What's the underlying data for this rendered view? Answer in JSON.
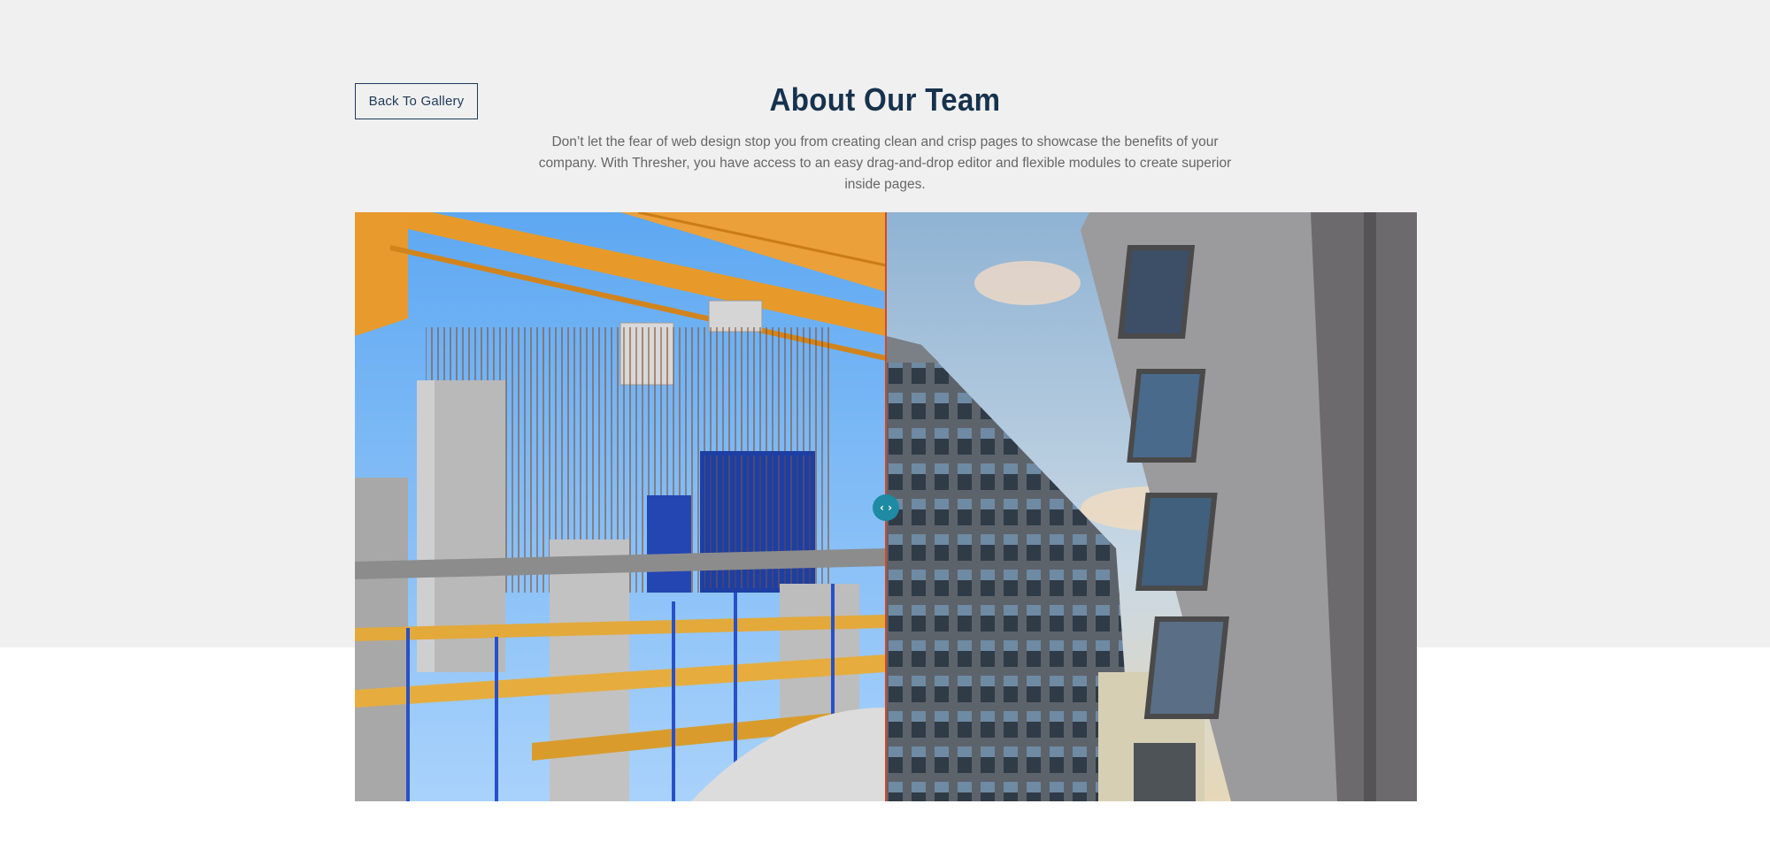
{
  "header": {
    "back_label": "Back To Gallery",
    "title": "About Our Team",
    "description": "Don’t let the fear of web design stop you from creating clean and crisp pages to showcase the benefits of your company. With Thresher, you have access to an easy drag-and-drop editor and flexible modules to create superior inside pages."
  },
  "comparison": {
    "before_image": "construction-site-image",
    "after_image": "office-building-image",
    "handle_icon": "left-right-arrows-icon",
    "divider_color": "#d1492a",
    "handle_color": "#1e8aa3",
    "handle_glyph": "‹ ›"
  }
}
